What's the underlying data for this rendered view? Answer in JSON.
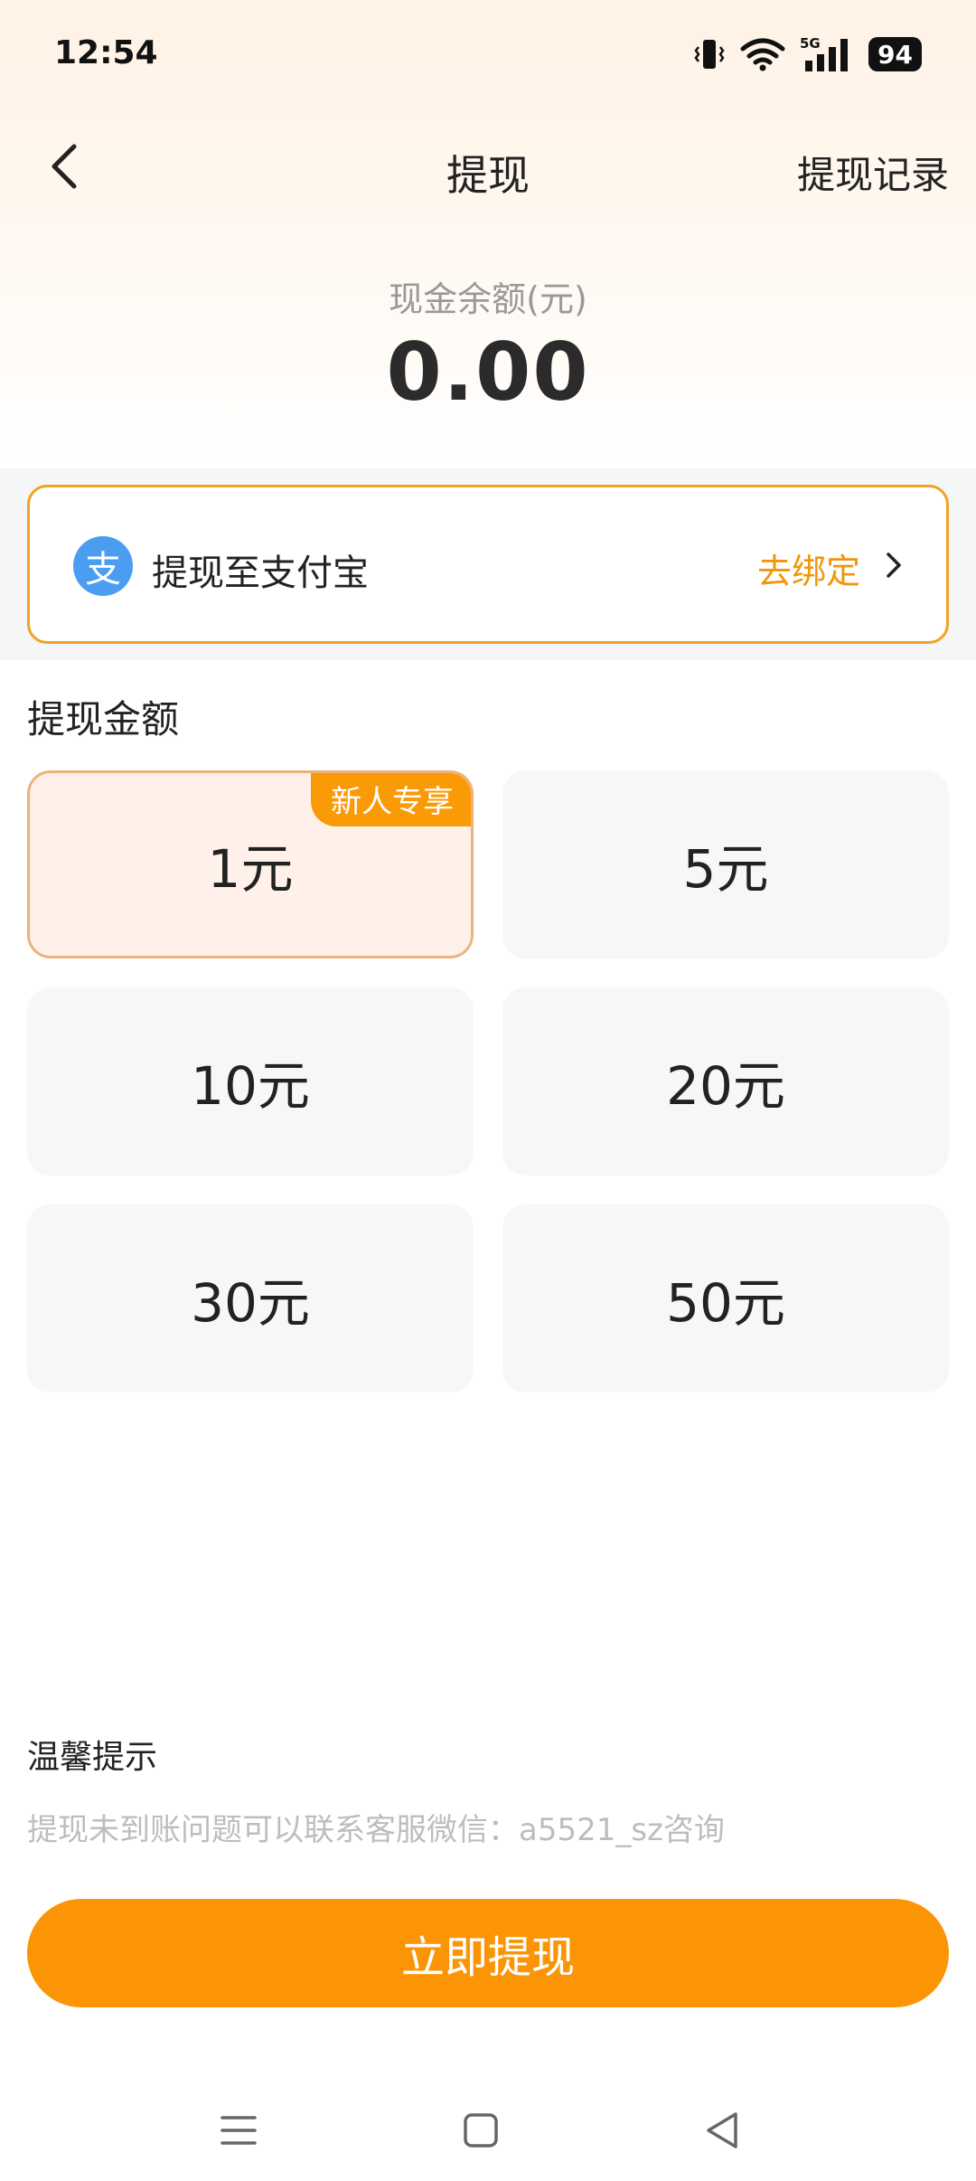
{
  "status_bar": {
    "time": "12:54",
    "network": "5G",
    "battery": "94"
  },
  "header": {
    "back_icon": "back-arrow-icon",
    "title": "提现",
    "history_label": "提现记录"
  },
  "balance": {
    "label": "现金余额(元)",
    "amount": "0.00"
  },
  "alipay": {
    "icon_glyph": "支",
    "label": "提现至支付宝",
    "bind_label": "去绑定",
    "accent_color": "#f1a224"
  },
  "amounts": {
    "title": "提现金额",
    "badge": "新人专享",
    "options": [
      "1元",
      "5元",
      "10元",
      "20元",
      "30元",
      "50元"
    ],
    "selected": "1元"
  },
  "tips": {
    "title": "温馨提示",
    "text": "提现未到账问题可以联系客服微信：a5521_sz咨询"
  },
  "actions": {
    "withdraw_label": "立即提现",
    "button_color": "#fb9506"
  },
  "nav": {
    "icons": [
      "menu-icon",
      "home-square-icon",
      "back-triangle-icon"
    ]
  }
}
